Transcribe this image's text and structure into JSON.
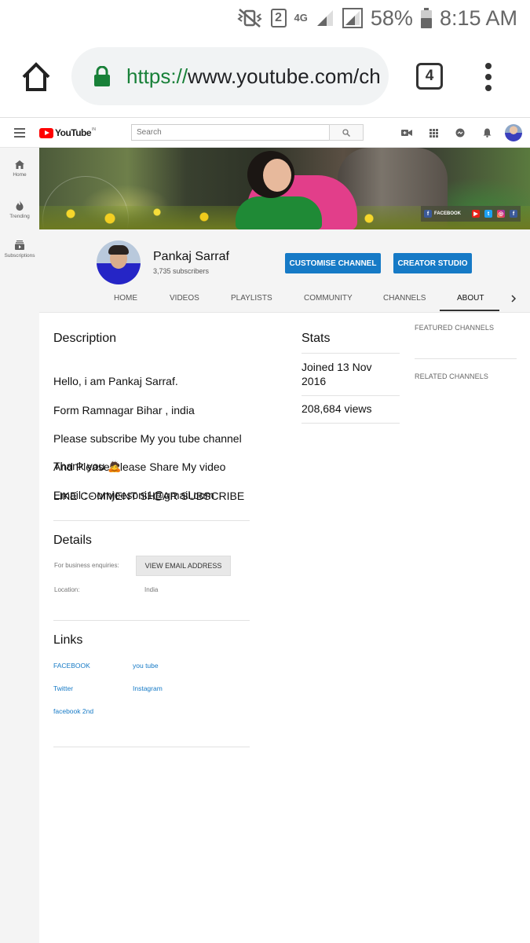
{
  "status_bar": {
    "sim_slot": "2",
    "network": "4G",
    "battery": "58%",
    "time": "8:15 AM"
  },
  "browser": {
    "url_scheme": "https://",
    "url_rest": "www.youtube.com/ch",
    "tab_count": "4"
  },
  "masthead": {
    "logo_text": "YouTube",
    "country_code": "IN",
    "search_placeholder": "Search"
  },
  "guide": {
    "items": [
      {
        "label": "Home",
        "icon": "home-icon"
      },
      {
        "label": "Trending",
        "icon": "flame-icon"
      },
      {
        "label": "Subscriptions",
        "icon": "subscriptions-icon"
      }
    ]
  },
  "banner": {
    "links_label": "FACEBOOK"
  },
  "channel": {
    "name": "Pankaj Sarraf",
    "subscribers": "3,735 subscribers",
    "customise_label": "CUSTOMISE CHANNEL",
    "studio_label": "CREATOR STUDIO",
    "tabs": [
      "HOME",
      "VIDEOS",
      "PLAYLISTS",
      "COMMUNITY",
      "CHANNELS",
      "ABOUT"
    ],
    "active_tab": "ABOUT"
  },
  "about": {
    "description_title": "Description",
    "description_lines": [
      "Hello, i am Pankaj Sarraf.",
      "Form Ramnagar Bihar , india",
      "Please subscribe My you tube channel",
      "And Please Please Share My video",
      "LIKE COMMENT SHEAR SUBSCRIBE"
    ],
    "thank_you": "Thank you 🙇",
    "email_line": "Email : - omjeesoni1@gmail.com",
    "details_title": "Details",
    "business_label": "For business enquiries:",
    "view_email_label": "VIEW EMAIL ADDRESS",
    "location_label": "Location:",
    "location_value": "India",
    "links_title": "Links",
    "links": [
      "FACEBOOK",
      "you tube",
      "Twitter",
      "Instagram",
      "facebook 2nd"
    ]
  },
  "stats": {
    "title": "Stats",
    "joined": "Joined 13 Nov 2016",
    "views": "208,684 views"
  },
  "sidebar": {
    "featured_label": "FEATURED CHANNELS",
    "related_label": "RELATED CHANNELS"
  },
  "colors": {
    "yt_red": "#ff0000",
    "button_blue": "#167ac6",
    "lock_green": "#188038"
  }
}
